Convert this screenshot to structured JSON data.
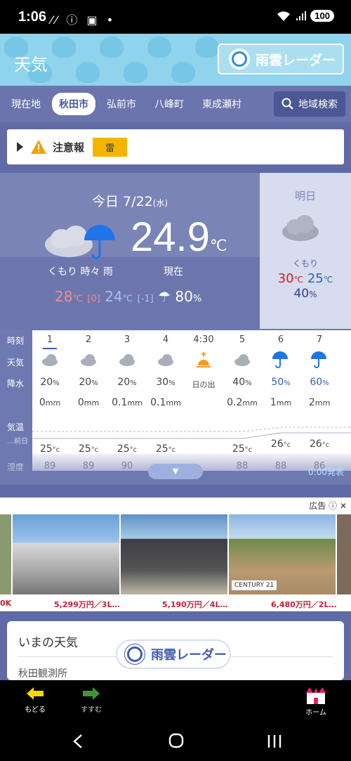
{
  "status": {
    "time": "1:06",
    "icons": "⁄⁄ ⓘ ▣ •",
    "battery": "100"
  },
  "header": {
    "title": "天気",
    "radar_label": "雨雲レーダー"
  },
  "tabs": [
    {
      "label": "現在地"
    },
    {
      "label": "秋田市",
      "active": true
    },
    {
      "label": "弘前市"
    },
    {
      "label": "八峰町"
    },
    {
      "label": "東成瀬村"
    }
  ],
  "search_label": "地域検索",
  "alert": {
    "label": "注意報",
    "badge": "雷"
  },
  "today": {
    "date": "今日 7/22",
    "weekday": "(水)",
    "temp": "24.9",
    "temp_unit": "℃",
    "condition": "くもり 時々 雨",
    "now_label": "現在",
    "high": "28",
    "high_unit": "℃",
    "high_diff": "[0]",
    "low": "24",
    "low_unit": "℃",
    "low_diff": "[-1]",
    "rain": "80",
    "rain_unit": "%"
  },
  "tomorrow": {
    "title": "明日",
    "condition": "くもり",
    "high": "30",
    "high_unit": "℃",
    "low": "25",
    "low_unit": "℃",
    "rain": "40",
    "rain_unit": "%"
  },
  "hourly": {
    "labels": {
      "time": "時刻",
      "weather": "天気",
      "precip": "降水",
      "temp": "気温",
      "prev": "…前日",
      "humidity": "湿度"
    },
    "hours": [
      {
        "time": "1",
        "icon": "cloud",
        "precip": "20",
        "amount": "0",
        "temp": "25",
        "hum": "89"
      },
      {
        "time": "2",
        "icon": "cloud",
        "precip": "20",
        "amount": "0",
        "temp": "25",
        "hum": "89"
      },
      {
        "time": "3",
        "icon": "cloud",
        "precip": "20",
        "amount": "0.1",
        "temp": "25",
        "hum": "90"
      },
      {
        "time": "4",
        "icon": "cloud",
        "precip": "30",
        "amount": "0.1",
        "temp": "25",
        "hum": ""
      },
      {
        "time": "4:30",
        "icon": "sunrise",
        "precip": "日の出",
        "amount": "",
        "temp": "",
        "hum": ""
      },
      {
        "time": "5",
        "icon": "cloud",
        "precip": "40",
        "amount": "0.2",
        "temp": "25",
        "hum": "88"
      },
      {
        "time": "6",
        "icon": "umbrella",
        "precip": "50",
        "amount": "1",
        "temp": "26",
        "hum": "88"
      },
      {
        "time": "7",
        "icon": "umbrella",
        "precip": "60",
        "amount": "2",
        "temp": "26",
        "hum": "86"
      }
    ],
    "pct_unit": "%",
    "mm_unit": "mm",
    "c_unit": "°c",
    "issued": "0:00発表"
  },
  "ad": {
    "tag": "広告",
    "prices": [
      "0K",
      "5,299万円／3L…",
      "5,190万円／4L…",
      "6,480万円／2L…"
    ],
    "brand": "CENTURY 21"
  },
  "nowcard": {
    "title": "いまの天気",
    "obs": "秋田観測所"
  },
  "float_radar": "雨雲レーダー",
  "bottomnav": {
    "back": "もどる",
    "forward": "すすむ",
    "home": "ホーム"
  }
}
